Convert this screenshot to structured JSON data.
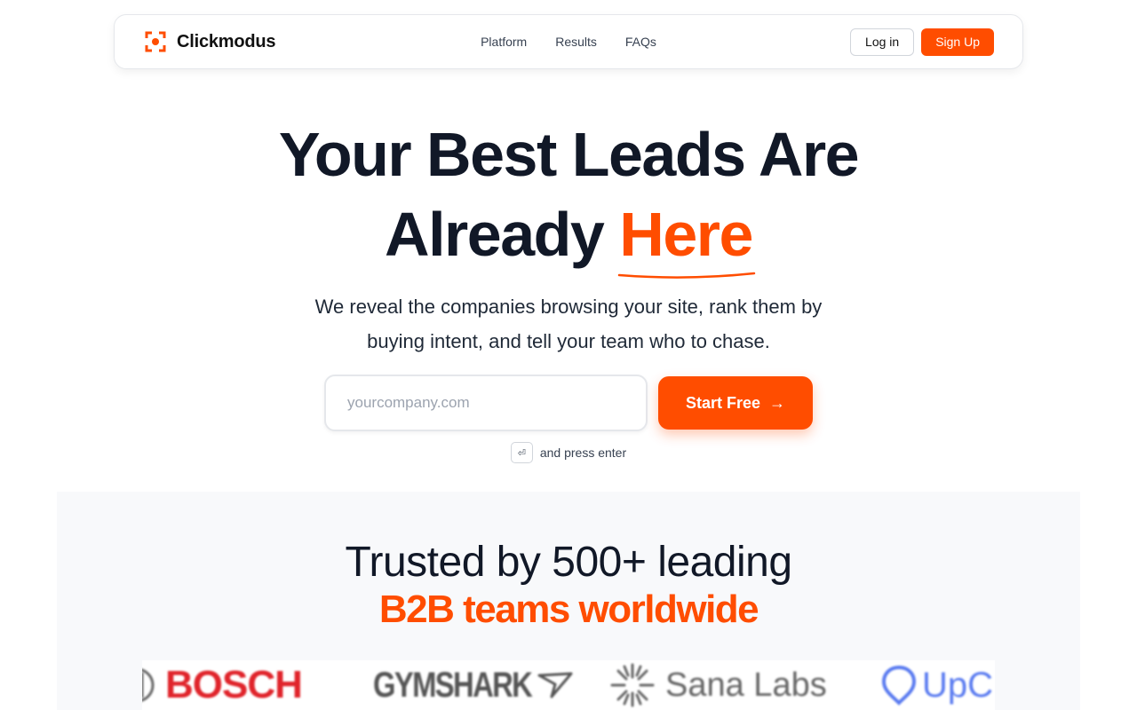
{
  "nav": {
    "brand": "Clickmodus",
    "links": [
      "Platform",
      "Results",
      "FAQs"
    ],
    "login_label": "Log in",
    "signup_label": "Sign Up"
  },
  "hero": {
    "title_line1": "Your Best Leads Are",
    "title_line2_prefix": "Already ",
    "title_line2_accent": "Here",
    "subtitle_line1": "We reveal the companies browsing your site, rank them by",
    "subtitle_line2": "buying intent, and tell your team who to chase.",
    "input_placeholder": "yourcompany.com",
    "start_label": "Start Free",
    "start_arrow": "→",
    "enter_key": "⏎",
    "hint_text": "and press enter"
  },
  "trusted": {
    "line1": "Trusted by 500+ leading",
    "line2": "B2B teams worldwide"
  },
  "logos": {
    "bosch": "BOSCH",
    "gymshark": "GYMSHARK",
    "sana": "Sana Labs",
    "upc": "UpC"
  },
  "colors": {
    "accent": "#ff4d00",
    "text": "#111827"
  }
}
